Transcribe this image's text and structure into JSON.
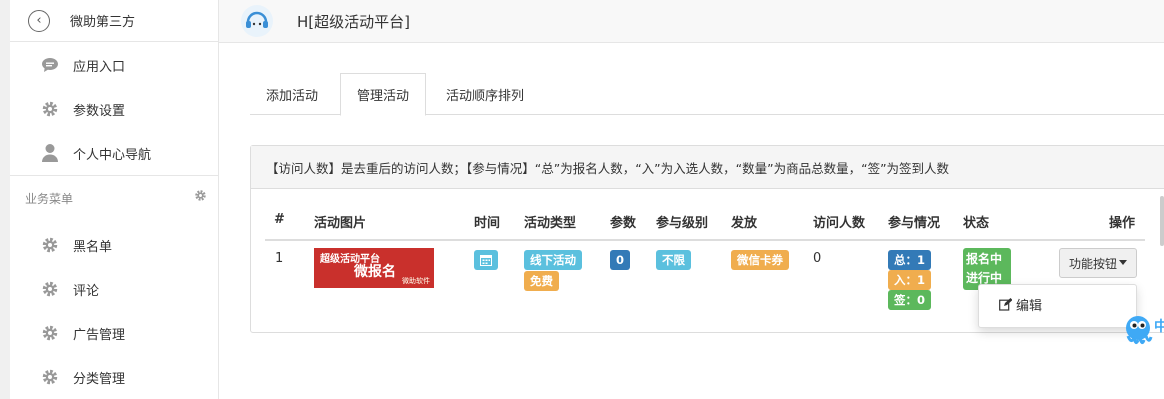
{
  "sidebar": {
    "header": {
      "back_glyph": "‹",
      "title": "微助第三方"
    },
    "items_top": [
      {
        "label": "应用入口",
        "icon": "chat-icon"
      },
      {
        "label": "参数设置",
        "icon": "gear-icon"
      },
      {
        "label": "个人中心导航",
        "icon": "user-icon"
      }
    ],
    "group": {
      "label": "业务菜单",
      "icon": "gear-icon"
    },
    "items_bottom": [
      {
        "label": "黑名单",
        "icon": "gear-icon"
      },
      {
        "label": "评论",
        "icon": "gear-icon"
      },
      {
        "label": "广告管理",
        "icon": "gear-icon"
      },
      {
        "label": "分类管理",
        "icon": "gear-icon"
      }
    ]
  },
  "topbar": {
    "title": "H[超级活动平台]",
    "logo_icon": "headset-icon"
  },
  "tabs": [
    {
      "label": "添加活动",
      "active": false
    },
    {
      "label": "管理活动",
      "active": true
    },
    {
      "label": "活动顺序排列",
      "active": false
    }
  ],
  "panel": {
    "note": "【访问人数】是去重后的访问人数；【参与情况】“总”为报名人数，“入”为入选人数，“数量”为商品总数量，“签”为签到人数"
  },
  "table": {
    "headers": [
      "#",
      "活动图片",
      "时间",
      "活动类型",
      "参数",
      "参与级别",
      "发放",
      "访问人数",
      "参与情况",
      "状态",
      "操作"
    ],
    "rows": [
      {
        "index": "1",
        "image": {
          "line1": "超级活动平台",
          "line2": "微报名",
          "line3": "微助软件"
        },
        "time_icon": "calendar-icon",
        "type_labels": [
          "线下活动",
          "免费"
        ],
        "param": "0",
        "level": "不限",
        "grant": "微信卡券",
        "visits": "0",
        "participation": [
          "总：1",
          "入：1",
          "签：0"
        ],
        "status": [
          "报名中",
          "进行中"
        ],
        "action_button": "功能按钮",
        "dropdown": [
          {
            "label": "编辑",
            "icon": "edit-icon"
          }
        ]
      }
    ]
  },
  "overlay": {
    "mascot_text": "中"
  },
  "colors": {
    "info": "#5bc0de",
    "warning": "#f0ad4e",
    "primary": "#337ab7",
    "success": "#5cb85c",
    "danger": "#c9302c"
  }
}
